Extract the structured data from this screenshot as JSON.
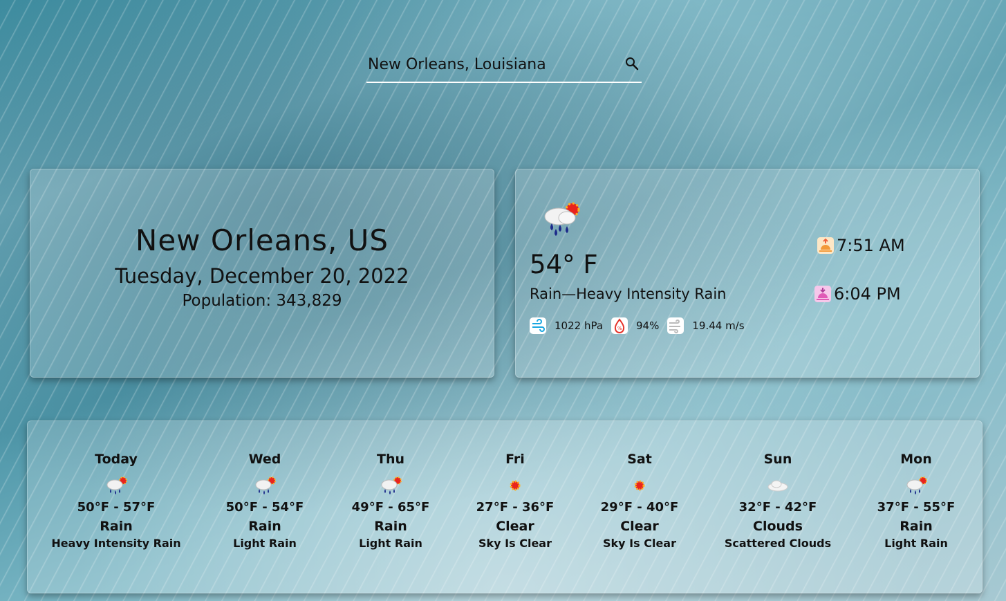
{
  "search": {
    "value": "New Orleans, Louisiana"
  },
  "location": {
    "city": "New Orleans, US",
    "date": "Tuesday, December 20, 2022",
    "population": "Population: 343,829"
  },
  "current": {
    "icon": "rain-sun-icon",
    "temperature": "54° F",
    "description": "Rain—Heavy Intensity Rain",
    "pressure": "1022 hPa",
    "humidity": "94%",
    "wind": "19.44 m/s",
    "sunrise": "7:51 AM",
    "sunset": "6:04 PM"
  },
  "forecast": [
    {
      "day": "Today",
      "icon": "rain-sun-icon",
      "range": "50°F - 57°F",
      "main": "Rain",
      "detail": "Heavy Intensity Rain"
    },
    {
      "day": "Wed",
      "icon": "rain-sun-icon",
      "range": "50°F - 54°F",
      "main": "Rain",
      "detail": "Light Rain"
    },
    {
      "day": "Thu",
      "icon": "rain-sun-icon",
      "range": "49°F - 65°F",
      "main": "Rain",
      "detail": "Light Rain"
    },
    {
      "day": "Fri",
      "icon": "sun-icon",
      "range": "27°F - 36°F",
      "main": "Clear",
      "detail": "Sky Is Clear"
    },
    {
      "day": "Sat",
      "icon": "sun-icon",
      "range": "29°F - 40°F",
      "main": "Clear",
      "detail": "Sky Is Clear"
    },
    {
      "day": "Sun",
      "icon": "cloud-icon",
      "range": "32°F - 42°F",
      "main": "Clouds",
      "detail": "Scattered Clouds"
    },
    {
      "day": "Mon",
      "icon": "rain-sun-icon",
      "range": "37°F - 55°F",
      "main": "Rain",
      "detail": "Light Rain"
    }
  ]
}
